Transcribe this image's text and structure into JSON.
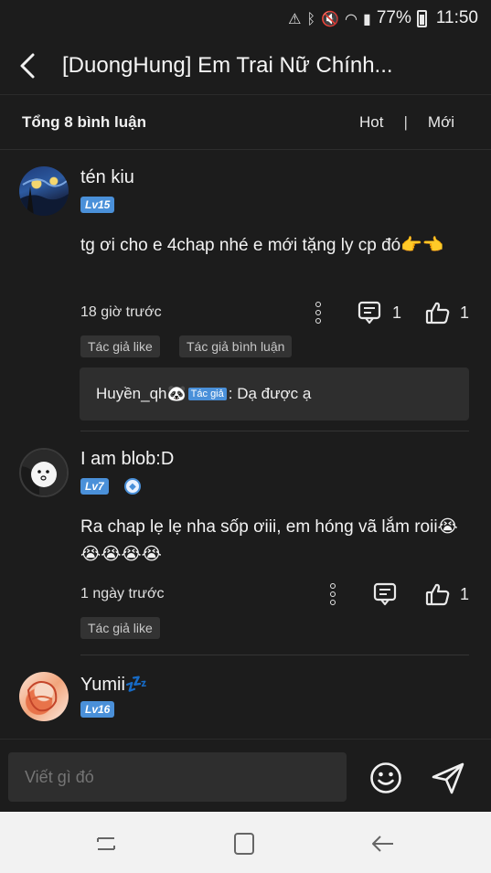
{
  "status_bar": {
    "battery": "77%",
    "time": "11:50"
  },
  "header": {
    "title": "[DuongHung] Em Trai Nữ Chính..."
  },
  "summary": {
    "count_label": "Tổng 8 bình luận",
    "sort_hot": "Hot",
    "sort_separator": "|",
    "sort_new": "Mới"
  },
  "comments": [
    {
      "username": "tén kiu",
      "level": "Lv15",
      "content": "tg ơi cho e 4chap nhé e mới tặng ly cp đó👉👈",
      "time": "18 giờ trước",
      "reply_count": "1",
      "like_count": "1",
      "tags": [
        "Tác giả like",
        "Tác giả bình luận"
      ],
      "reply": {
        "user": "Huyền_qh🐼",
        "badge": "Tác giả",
        "text": ": Dạ được ạ"
      }
    },
    {
      "username": "I am blob:D",
      "level": "Lv7",
      "content": "Ra chap lẹ lẹ nha sốp ơiii, em hóng vã lắm roii😭😭😭😭😭",
      "time": "1 ngày trước",
      "like_count": "1",
      "tags": [
        "Tác giả like"
      ]
    },
    {
      "username": "Yumii💤",
      "level": "Lv16"
    }
  ],
  "composer": {
    "placeholder": "Viết gì đó"
  },
  "colors": {
    "background": "#1c1c1c",
    "level_badge": "#4a90d9",
    "tag_bg": "#333333",
    "nav_bar": "#f2f2f2"
  }
}
